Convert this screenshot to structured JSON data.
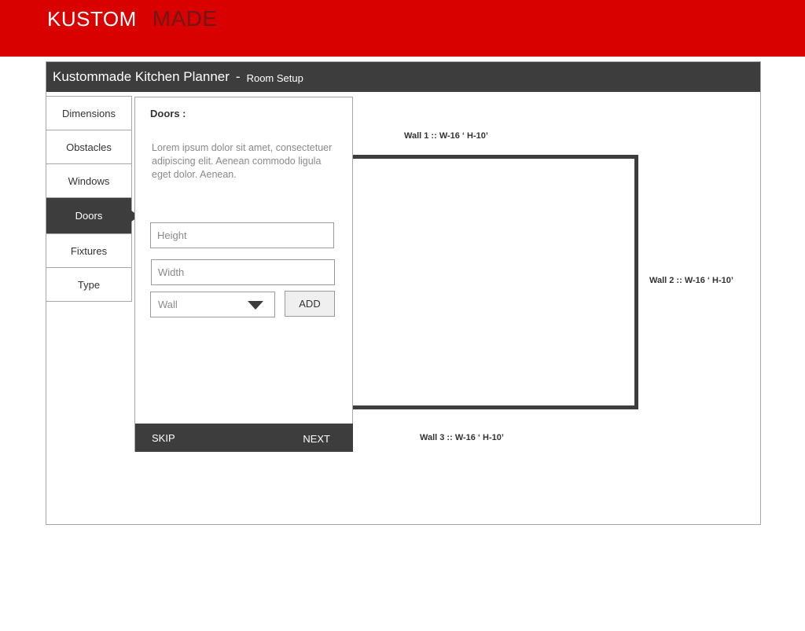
{
  "brand": {
    "part1": "KUSTOM",
    "part2": "MADE"
  },
  "header": {
    "title": "Kustommade Kitchen Planner",
    "separator": "-",
    "subtitle": "Room Setup"
  },
  "tabs": [
    {
      "label": "Dimensions"
    },
    {
      "label": "Obstacles"
    },
    {
      "label": "Windows"
    },
    {
      "label": "Doors"
    },
    {
      "label": "Fixtures"
    },
    {
      "label": "Type"
    }
  ],
  "active_tab": "Doors",
  "panel": {
    "heading": "Doors :",
    "description": "Lorem ipsum dolor sit amet, consectetuer adipiscing elit. Aenean commodo ligula eget dolor. Aenean.",
    "height_placeholder": "Height",
    "width_placeholder": "Width",
    "wall_select": "Wall",
    "add_label": "ADD",
    "skip_label": "SKIP",
    "next_label": "NEXT"
  },
  "room": {
    "wall1": "Wall 1 ::  W-16 ‘  H-10’",
    "wall2": "Wall 2 ::  W-16 ‘  H-10’",
    "wall3": "Wall 3 ::  W-16 ‘  H-10’"
  },
  "colors": {
    "brand_red": "#d90000",
    "dark": "#3d3d3d"
  }
}
